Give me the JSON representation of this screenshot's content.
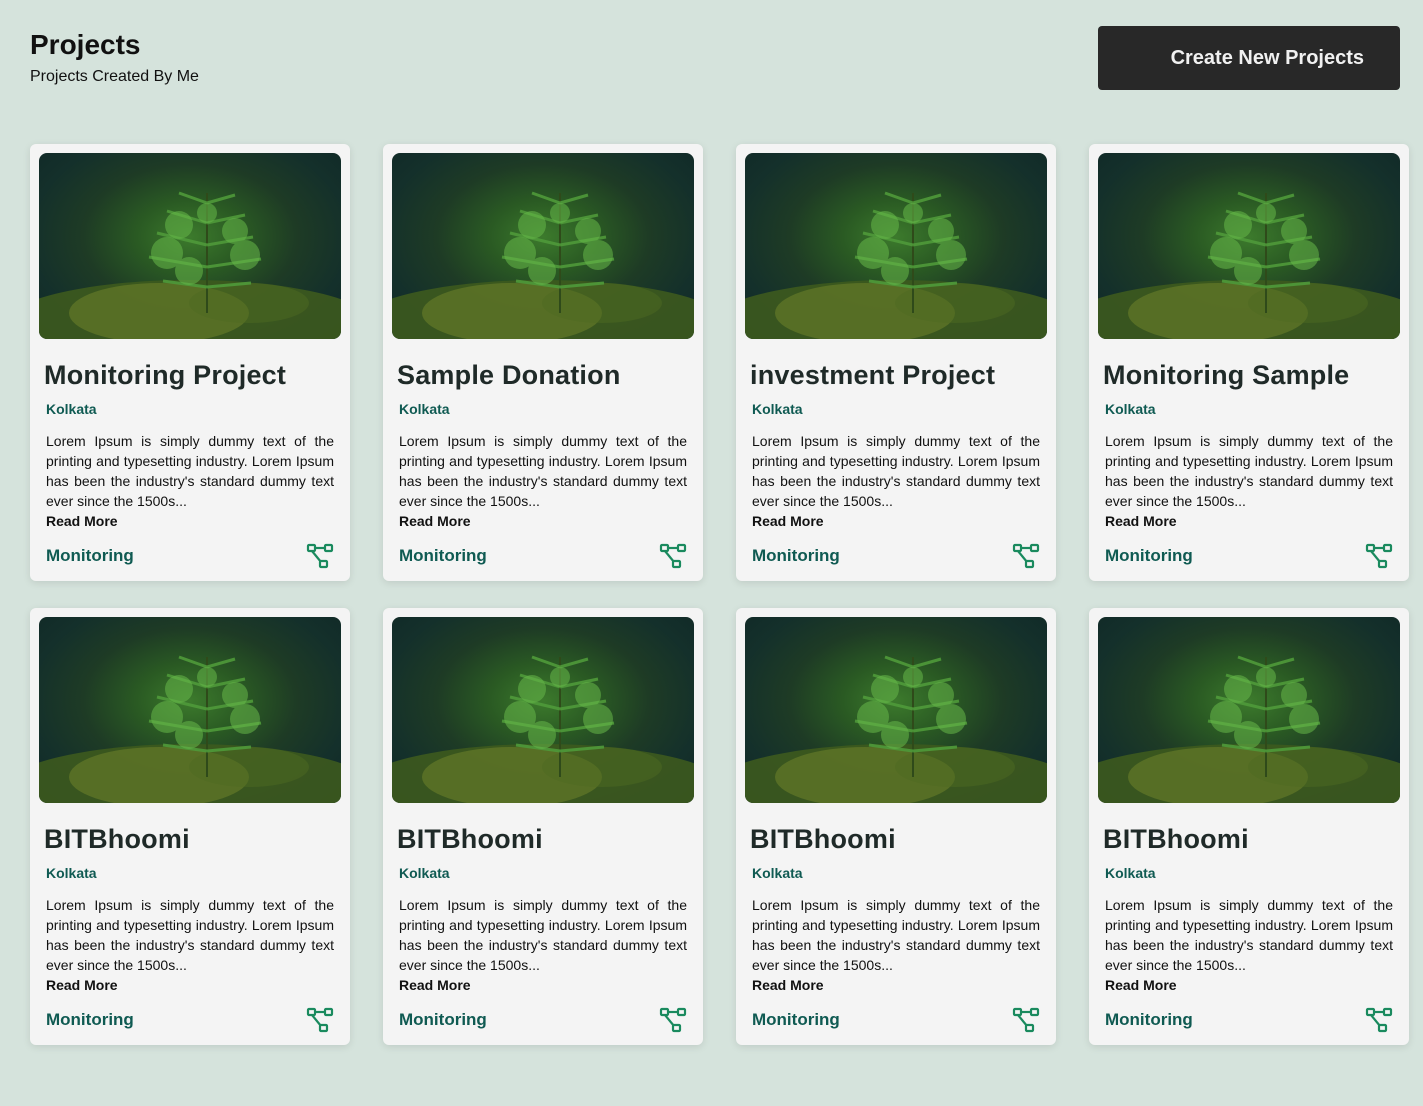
{
  "header": {
    "title": "Projects",
    "subtitle": "Projects Created By Me",
    "create_button_label": "Create New Projects"
  },
  "colors": {
    "accent": "#0f5a52",
    "button_bg": "#282828",
    "page_bg": "#d5e3dc",
    "card_bg": "#f4f4f4"
  },
  "projects": [
    {
      "title": "Monitoring Project",
      "location": "Kolkata",
      "description": "Lorem Ipsum is simply dummy text of the printing and typesetting industry. Lorem Ipsum has been the industry's standard dummy text ever since the 1500s...",
      "read_more": "Read More",
      "category": "Monitoring",
      "icon": "network-graph-icon"
    },
    {
      "title": "Sample Donation",
      "location": "Kolkata",
      "description": "Lorem Ipsum is simply dummy text of the printing and typesetting industry. Lorem Ipsum has been the industry's standard dummy text ever since the 1500s...",
      "read_more": "Read More",
      "category": "Monitoring",
      "icon": "network-graph-icon"
    },
    {
      "title": "investment Project",
      "location": "Kolkata",
      "description": "Lorem Ipsum is simply dummy text of the printing and typesetting industry. Lorem Ipsum has been the industry's standard dummy text ever since the 1500s...",
      "read_more": "Read More",
      "category": "Monitoring",
      "icon": "network-graph-icon"
    },
    {
      "title": "Monitoring Sample",
      "location": "Kolkata",
      "description": "Lorem Ipsum is simply dummy text of the printing and typesetting industry. Lorem Ipsum has been the industry's standard dummy text ever since the 1500s...",
      "read_more": "Read More",
      "category": "Monitoring",
      "icon": "network-graph-icon"
    },
    {
      "title": "BITBhoomi",
      "location": "Kolkata",
      "description": "Lorem Ipsum is simply dummy text of the printing and typesetting industry. Lorem Ipsum has been the industry's standard dummy text ever since the 1500s...",
      "read_more": "Read More",
      "category": "Monitoring",
      "icon": "network-graph-icon"
    },
    {
      "title": "BITBhoomi",
      "location": "Kolkata",
      "description": "Lorem Ipsum is simply dummy text of the printing and typesetting industry. Lorem Ipsum has been the industry's standard dummy text ever since the 1500s...",
      "read_more": "Read More",
      "category": "Monitoring",
      "icon": "network-graph-icon"
    },
    {
      "title": "BITBhoomi",
      "location": "Kolkata",
      "description": "Lorem Ipsum is simply dummy text of the printing and typesetting industry. Lorem Ipsum has been the industry's standard dummy text ever since the 1500s...",
      "read_more": "Read More",
      "category": "Monitoring",
      "icon": "network-graph-icon"
    },
    {
      "title": "BITBhoomi",
      "location": "Kolkata",
      "description": "Lorem Ipsum is simply dummy text of the printing and typesetting industry. Lorem Ipsum has been the industry's standard dummy text ever since the 1500s...",
      "read_more": "Read More",
      "category": "Monitoring",
      "icon": "network-graph-icon"
    }
  ]
}
